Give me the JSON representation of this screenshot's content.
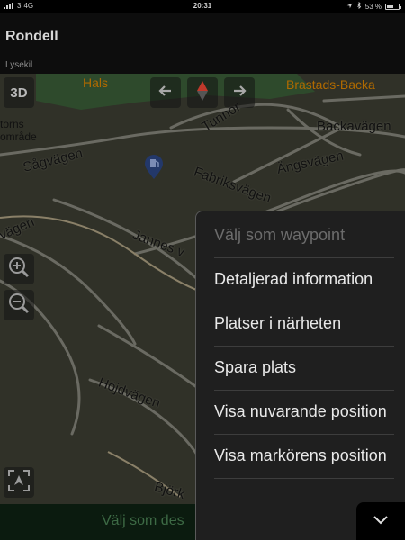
{
  "status_bar": {
    "carrier": "3",
    "network": "4G",
    "time": "20:31",
    "battery": "53 %",
    "battery_level": 0.53
  },
  "header": {
    "title": "Rondell",
    "subtitle": "Lysekil"
  },
  "map": {
    "button_3d": "3D",
    "places": [
      "Hals",
      "Brastads-Backa"
    ],
    "areas": [
      "torns",
      "område"
    ],
    "roads": [
      "Tunnor",
      "Backavägen",
      "Sågvägen",
      "Fabriksvägen",
      "Ängsvägen",
      "Jannes v",
      "vägen",
      "Höjdvägen",
      "Björk"
    ],
    "icons": {
      "nav_back": "arrow-left-icon",
      "compass": "compass-icon",
      "nav_forward": "arrow-right-icon",
      "zoom_in": "zoom-in-icon",
      "zoom_out": "zoom-out-icon",
      "recenter": "recenter-icon",
      "poi": "fuel-station-pin-icon"
    }
  },
  "bottom_bar": {
    "text": "Välj som des"
  },
  "menu": {
    "items": [
      {
        "label": "Välj som waypoint",
        "enabled": false
      },
      {
        "label": "Detaljerad information",
        "enabled": true
      },
      {
        "label": "Platser i närheten",
        "enabled": true
      },
      {
        "label": "Spara plats",
        "enabled": true
      },
      {
        "label": "Visa nuvarande position",
        "enabled": true
      },
      {
        "label": "Visa markörens position",
        "enabled": true
      }
    ],
    "collapse_icon": "chevron-down-icon"
  },
  "colors": {
    "map_bg": "#303128",
    "menu_bg": "#1f1f1f",
    "accent_red": "#c0392b",
    "place_orange": "#b06a00"
  }
}
